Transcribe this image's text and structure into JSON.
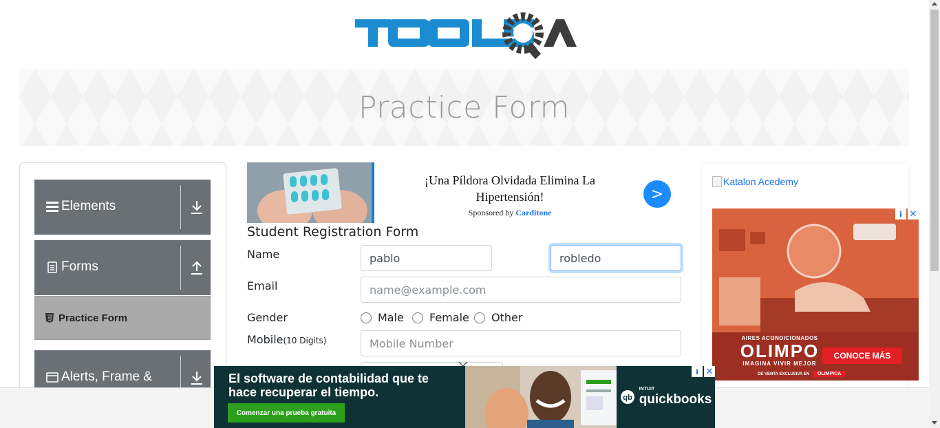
{
  "brand": {
    "logo_text": "TOOLSQA",
    "primary_color": "#1a8ccf",
    "secondary_color": "#3c3c3c"
  },
  "banner": {
    "title": "Practice Form"
  },
  "sidebar": {
    "groups": [
      {
        "label": "Elements",
        "icon": "list-icon",
        "arrow": "down"
      },
      {
        "label": "Forms",
        "icon": "document-icon",
        "arrow": "up"
      },
      {
        "label": "Alerts, Frame &",
        "icon": "window-icon",
        "arrow": "down"
      }
    ],
    "active_item": {
      "label": "Practice Form",
      "icon": "html5-icon"
    }
  },
  "top_ad": {
    "headline": "¡Una Píldora Olvidada Elimina La Hipertensión!",
    "sponsored_prefix": "Sponsored by",
    "sponsor": "Carditone",
    "button": ">"
  },
  "form": {
    "title": "Student Registration Form",
    "name_label": "Name",
    "first_name_value": "pablo",
    "last_name_value": "robledo",
    "email_label": "Email",
    "email_placeholder": "name@example.com",
    "gender_label": "Gender",
    "gender_options": [
      "Male",
      "Female",
      "Other"
    ],
    "mobile_label": "Mobile",
    "mobile_hint": "(10 Digits)",
    "mobile_placeholder": "Mobile Number"
  },
  "right_ad": {
    "katalon_alt": "Katalon Acedemy",
    "olimpo_kicker": "AIRES ACONDICIONADOS",
    "olimpo_brand": "OLIMPO",
    "olimpo_tagline": "IMAGINA VIVIR MEJOR",
    "olimpo_cta": "CONOCE MÁS",
    "olimpo_footer": "DE VENTA EXCLUSIVA EN",
    "olimpo_store": "OLIMPICA"
  },
  "bottom_ad": {
    "headline": "El software de contabilidad que te hace recuperar el tiempo.",
    "cta": "Comenzar una prueba gratuita",
    "brand_small": "INTUIT",
    "brand": "quickbooks"
  },
  "ad_controls": {
    "info": "i",
    "close": "✕"
  }
}
